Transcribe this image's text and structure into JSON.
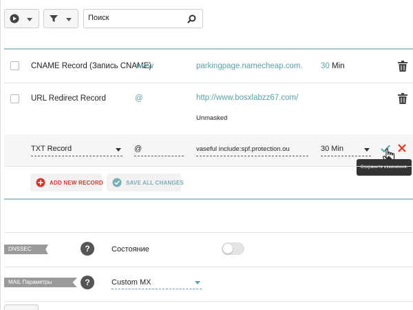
{
  "toolbar": {
    "play_icon": "play-circle-icon",
    "filter_icon": "filter-icon",
    "search_placeholder": "Поиск",
    "search_icon": "search-icon"
  },
  "records": [
    {
      "type": "CNAME Record (Запись CNAME)",
      "host": "www",
      "value": "parkingpage.namecheap.com.",
      "ttl_num": "30",
      "ttl_unit": "Min"
    },
    {
      "type": "URL Redirect Record",
      "host": "@",
      "value": "http://www.bosxlabzz67.com/",
      "note": "Unmasked"
    }
  ],
  "edit_row": {
    "type": "TXT Record",
    "host": "@",
    "value": "vaseful include:spf.protection.ou",
    "ttl": "30 Min",
    "tooltip": "Сохраните изменения."
  },
  "actions": {
    "add_label": "ADD NEW RECORD",
    "save_all_label": "SAVE ALL CHANGES"
  },
  "dnssec": {
    "tag": "DNSSEC",
    "help": "?",
    "status_label": "Состояние",
    "enabled": false
  },
  "mail": {
    "tag": "MAIL Параметры",
    "help": "?",
    "selected": "Custom MX"
  },
  "colors": {
    "accent": "#5aa0a9",
    "add_icon": "#d9342b",
    "delete": "#e0452b"
  }
}
